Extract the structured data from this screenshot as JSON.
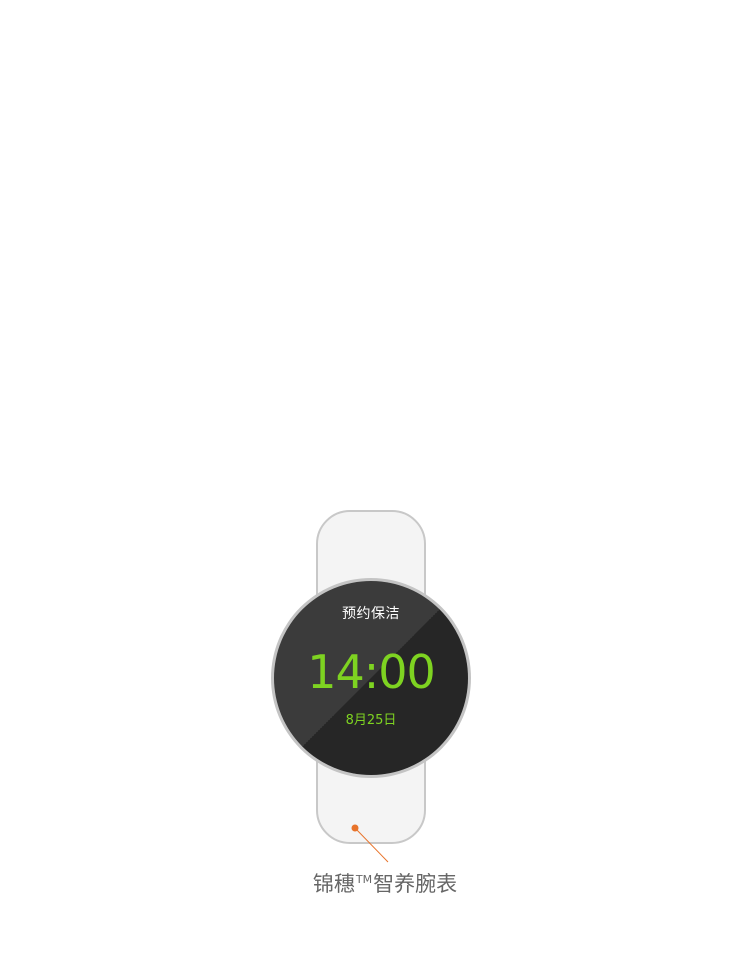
{
  "watch": {
    "screen_title": "预约保洁",
    "time": "14:00",
    "date": "8月25日"
  },
  "caption": {
    "brand": "锦穗",
    "trademark": "TM",
    "product": "智养腕表"
  },
  "colors": {
    "accent_green": "#7ed321",
    "callout_orange": "#e8732a",
    "caption_gray": "#666666"
  }
}
